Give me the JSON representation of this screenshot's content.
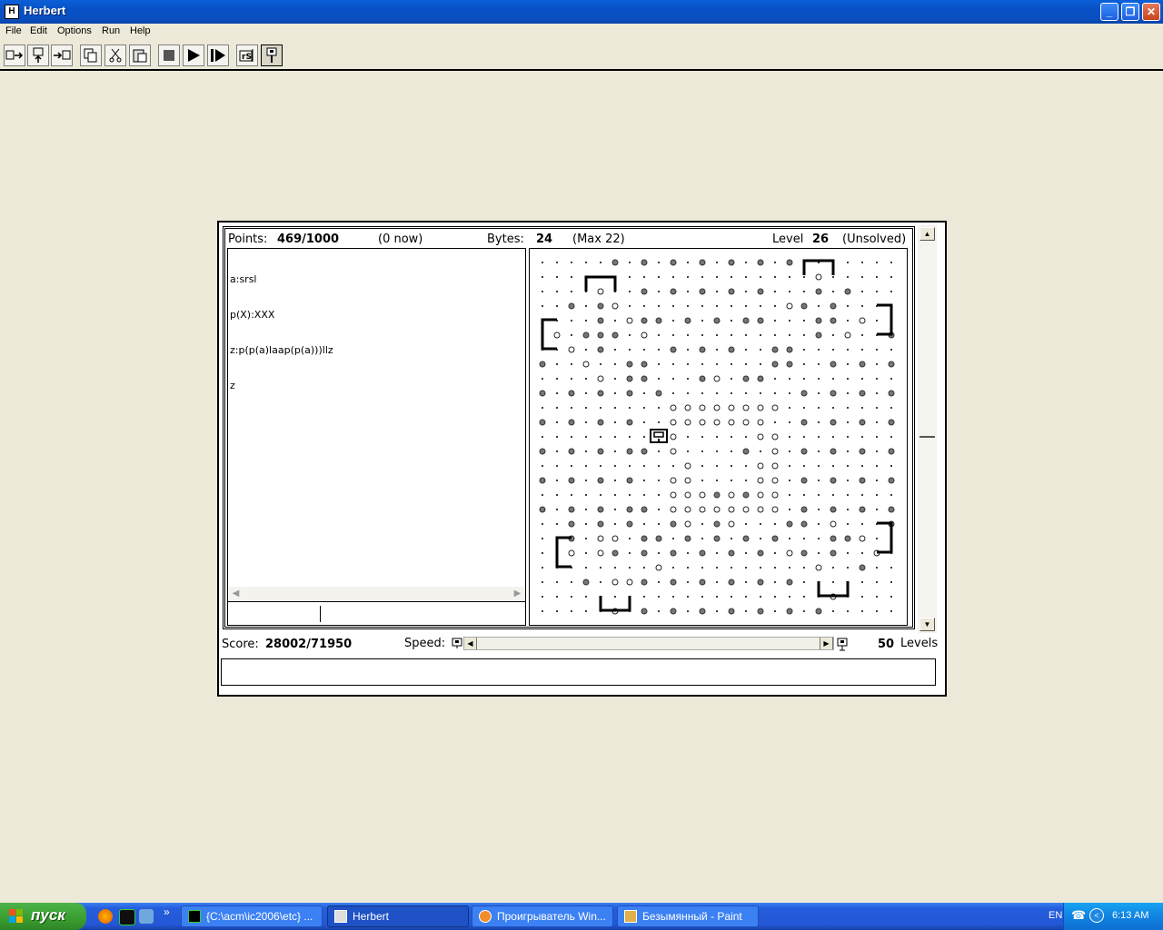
{
  "window": {
    "title": "Herbert",
    "icon_label": "H"
  },
  "controls": {
    "minimize": "_",
    "restore": "❐",
    "close": "✕"
  },
  "menu": [
    "File",
    "Edit",
    "Options",
    "Run",
    "Help"
  ],
  "toolbar_icons": [
    "open-icon",
    "save-icon",
    "export-icon",
    "copy-icon",
    "cut-icon",
    "paste-icon",
    "stop-icon",
    "play-icon",
    "step-icon",
    "reset-icon",
    "robot-icon"
  ],
  "stats": {
    "points_label": "Points:",
    "points": "469/1000",
    "now": "(0 now)",
    "bytes_label": "Bytes:",
    "bytes": "24",
    "max": "(Max 22)",
    "level_label": "Level",
    "level": "26",
    "state": "(Unsolved)"
  },
  "code_lines": [
    "a:srsl",
    "p(X):XXX",
    "z:p(p(a)laap(p(a)))llz",
    "z"
  ],
  "footer": {
    "score_label": "Score:",
    "score": "28002/71950",
    "speed_label": "Speed:",
    "levels_count": "50",
    "levels_label": "Levels"
  },
  "message": "",
  "taskbar": {
    "start": "пуск",
    "tasks": [
      {
        "label": "{C:\\acm\\ic2006\\etc} ...",
        "active": false
      },
      {
        "label": "Herbert",
        "active": true
      },
      {
        "label": "Проигрыватель Win...",
        "active": false
      },
      {
        "label": "Безымянный - Paint",
        "active": false
      }
    ],
    "lang": "EN",
    "time": "6:13 AM",
    "chevron": "»"
  },
  "colors": {
    "titlebar": "#0A5FD8",
    "background": "#ECE9D8",
    "taskbar": "#245EDC",
    "start": "#3A9D2F"
  }
}
